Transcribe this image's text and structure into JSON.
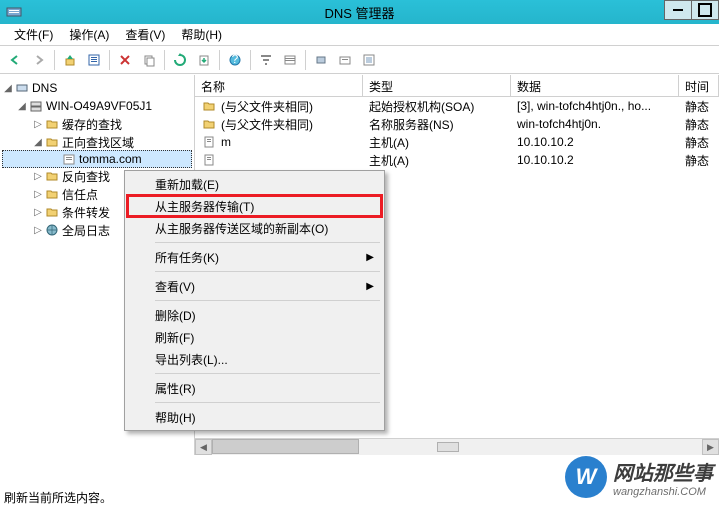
{
  "window": {
    "title": "DNS 管理器"
  },
  "menu": {
    "file": "文件(F)",
    "action": "操作(A)",
    "view": "查看(V)",
    "help": "帮助(H)"
  },
  "tree": {
    "root": "DNS",
    "server": "WIN-O49A9VF05J1",
    "cache": "缓存的查找",
    "fwd": "正向查找区域",
    "zone": "tomma.com",
    "rev": "反向查找",
    "trust": "信任点",
    "cond": "条件转发",
    "global": "全局日志"
  },
  "cols": {
    "name": "名称",
    "type": "类型",
    "data": "数据",
    "time": "时间"
  },
  "rows": [
    {
      "name": "(与父文件夹相同)",
      "type": "起始授权机构(SOA)",
      "data": "[3], win-tofch4htj0n., ho...",
      "time": "静态",
      "icon": "folder"
    },
    {
      "name": "(与父文件夹相同)",
      "type": "名称服务器(NS)",
      "data": "win-tofch4htj0n.",
      "time": "静态",
      "icon": "folder"
    },
    {
      "name": "m",
      "type": "主机(A)",
      "data": "10.10.10.2",
      "time": "静态",
      "icon": "page"
    },
    {
      "name": "",
      "type": "主机(A)",
      "data": "10.10.10.2",
      "time": "静态",
      "icon": "page"
    }
  ],
  "ctx": {
    "reload": "重新加载(E)",
    "transfer": "从主服务器传输(T)",
    "newcopy": "从主服务器传送区域的新副本(O)",
    "alltasks": "所有任务(K)",
    "view": "查看(V)",
    "delete": "删除(D)",
    "refresh": "刷新(F)",
    "export": "导出列表(L)...",
    "props": "属性(R)",
    "help": "帮助(H)"
  },
  "status": "刷新当前所选内容。",
  "watermark": {
    "text": "网站那些事",
    "url": "wangzhanshi.COM"
  }
}
